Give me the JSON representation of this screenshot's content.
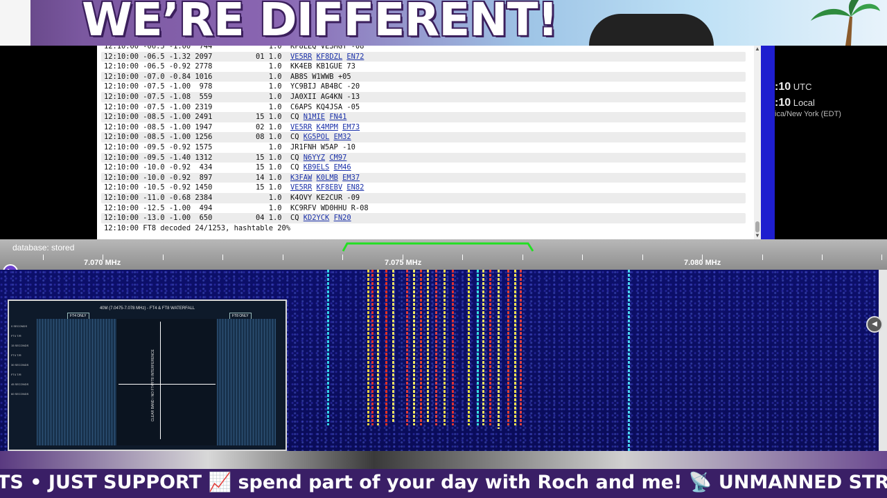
{
  "banner": {
    "text": "WE’RE DIFFERENT!"
  },
  "log": {
    "rows": [
      {
        "time": "12:10:00",
        "snr": "-06.5",
        "dt": "-1.00",
        "freq": " 744",
        "marker": "  ",
        "pct": "1.0",
        "msg": [
          {
            "t": "KF8LEQ VE3MGY -08"
          }
        ]
      },
      {
        "time": "12:10:00",
        "snr": "-06.5",
        "dt": "-1.32",
        "freq": "2097",
        "marker": "01",
        "pct": "1.0",
        "msg": [
          {
            "t": "VE5RR",
            "link": true
          },
          {
            "t": "KF8DZL",
            "link": true
          },
          {
            "t": "EN72",
            "link": true
          }
        ]
      },
      {
        "time": "12:10:00",
        "snr": "-06.5",
        "dt": "-0.92",
        "freq": "2778",
        "marker": "  ",
        "pct": "1.0",
        "msg": [
          {
            "t": "KK4EB KB1GUE 73"
          }
        ]
      },
      {
        "time": "12:10:00",
        "snr": "-07.0",
        "dt": "-0.84",
        "freq": "1016",
        "marker": "  ",
        "pct": "1.0",
        "msg": [
          {
            "t": "AB8S W1WWB +05"
          }
        ]
      },
      {
        "time": "12:10:00",
        "snr": "-07.5",
        "dt": "-1.00",
        "freq": " 978",
        "marker": "  ",
        "pct": "1.0",
        "msg": [
          {
            "t": "YC9BIJ AB4BC -20"
          }
        ]
      },
      {
        "time": "12:10:00",
        "snr": "-07.5",
        "dt": "-1.08",
        "freq": " 559",
        "marker": "  ",
        "pct": "1.0",
        "msg": [
          {
            "t": "JA0XII AG4KN -13"
          }
        ]
      },
      {
        "time": "12:10:00",
        "snr": "-07.5",
        "dt": "-1.00",
        "freq": "2319",
        "marker": "  ",
        "pct": "1.0",
        "msg": [
          {
            "t": "C6APS KQ4JSA -05"
          }
        ]
      },
      {
        "time": "12:10:00",
        "snr": "-08.5",
        "dt": "-1.00",
        "freq": "2491",
        "marker": "15",
        "pct": "1.0",
        "msg": [
          {
            "t": "CQ"
          },
          {
            "t": "N1MIE",
            "link": true
          },
          {
            "t": "FN41",
            "link": true
          }
        ]
      },
      {
        "time": "12:10:00",
        "snr": "-08.5",
        "dt": "-1.00",
        "freq": "1947",
        "marker": "02",
        "pct": "1.0",
        "msg": [
          {
            "t": "VE5RR",
            "link": true
          },
          {
            "t": "K4MPM",
            "link": true
          },
          {
            "t": "EM73",
            "link": true
          }
        ]
      },
      {
        "time": "12:10:00",
        "snr": "-08.5",
        "dt": "-1.00",
        "freq": "1256",
        "marker": "08",
        "pct": "1.0",
        "msg": [
          {
            "t": "CQ"
          },
          {
            "t": "KG5POL",
            "link": true
          },
          {
            "t": "EM32",
            "link": true
          }
        ]
      },
      {
        "time": "12:10:00",
        "snr": "-09.5",
        "dt": "-0.92",
        "freq": "1575",
        "marker": "  ",
        "pct": "1.0",
        "msg": [
          {
            "t": "JR1FNH W5AP -10"
          }
        ]
      },
      {
        "time": "12:10:00",
        "snr": "-09.5",
        "dt": "-1.40",
        "freq": "1312",
        "marker": "15",
        "pct": "1.0",
        "msg": [
          {
            "t": "CQ"
          },
          {
            "t": "N6YYZ",
            "link": true
          },
          {
            "t": "CM97",
            "link": true
          }
        ]
      },
      {
        "time": "12:10:00",
        "snr": "-10.0",
        "dt": "-0.92",
        "freq": " 434",
        "marker": "15",
        "pct": "1.0",
        "msg": [
          {
            "t": "CQ"
          },
          {
            "t": "KB9ELS",
            "link": true
          },
          {
            "t": "EM46",
            "link": true
          }
        ]
      },
      {
        "time": "12:10:00",
        "snr": "-10.0",
        "dt": "-0.92",
        "freq": " 897",
        "marker": "14",
        "pct": "1.0",
        "msg": [
          {
            "t": "K3FAW",
            "link": true
          },
          {
            "t": "K0LMB",
            "link": true
          },
          {
            "t": "EM37",
            "link": true
          }
        ]
      },
      {
        "time": "12:10:00",
        "snr": "-10.5",
        "dt": "-0.92",
        "freq": "1450",
        "marker": "15",
        "pct": "1.0",
        "msg": [
          {
            "t": "VE5RR",
            "link": true
          },
          {
            "t": "KF8EBV",
            "link": true
          },
          {
            "t": "EN82",
            "link": true
          }
        ]
      },
      {
        "time": "12:10:00",
        "snr": "-11.0",
        "dt": "-0.68",
        "freq": "2384",
        "marker": "  ",
        "pct": "1.0",
        "msg": [
          {
            "t": "K4OVY KE2CUR -09"
          }
        ]
      },
      {
        "time": "12:10:00",
        "snr": "-12.5",
        "dt": "-1.00",
        "freq": " 494",
        "marker": "  ",
        "pct": "1.0",
        "msg": [
          {
            "t": "KC9RFV WD0HHU R-08"
          }
        ]
      },
      {
        "time": "12:10:00",
        "snr": "-13.0",
        "dt": "-1.00",
        "freq": " 650",
        "marker": "04",
        "pct": "1.0",
        "msg": [
          {
            "t": "CQ"
          },
          {
            "t": "KD2YCK",
            "link": true
          },
          {
            "t": "FN20",
            "link": true
          }
        ]
      }
    ],
    "summary": "12:10:00 FT8 decoded 24/1253, hashtable 20%"
  },
  "clock": {
    "utc_time": ":10",
    "utc_label": "UTC",
    "local_time": ":10",
    "local_label": "Local",
    "timezone": "ica/New York (EDT)"
  },
  "scale": {
    "database_label": "database: stored",
    "freq_labels": [
      "7.070 MHz",
      "7.075 MHz",
      "7.080 MHz"
    ]
  },
  "inset": {
    "title": "40M (7.0475-7.078 MHz) - FT4 & FT8 WATERFALL",
    "tag_left": "FT4 ONLY",
    "tag_right": "FT8 ONLY",
    "center_label": "CLEAR BAND / NO FT4/FT8 INTERFERENCE",
    "axis": [
      "0 SECONDS",
      "FT4 T/R",
      "15 SECONDS",
      "FT4 T/R",
      "30 SECONDS",
      "FT4 T/R",
      "45 SECONDS",
      "60 SECONDS"
    ]
  },
  "ticker": {
    "text": "TS • JUST SUPPORT 📈 spend part of your day with Roch and me!     📡 UNMANNED STREA"
  },
  "colors": {
    "link": "#1a30a8",
    "waterfall_bg": "#0c0f6a",
    "passband": "#22e022",
    "ticker_bg": "#3a1f66"
  }
}
